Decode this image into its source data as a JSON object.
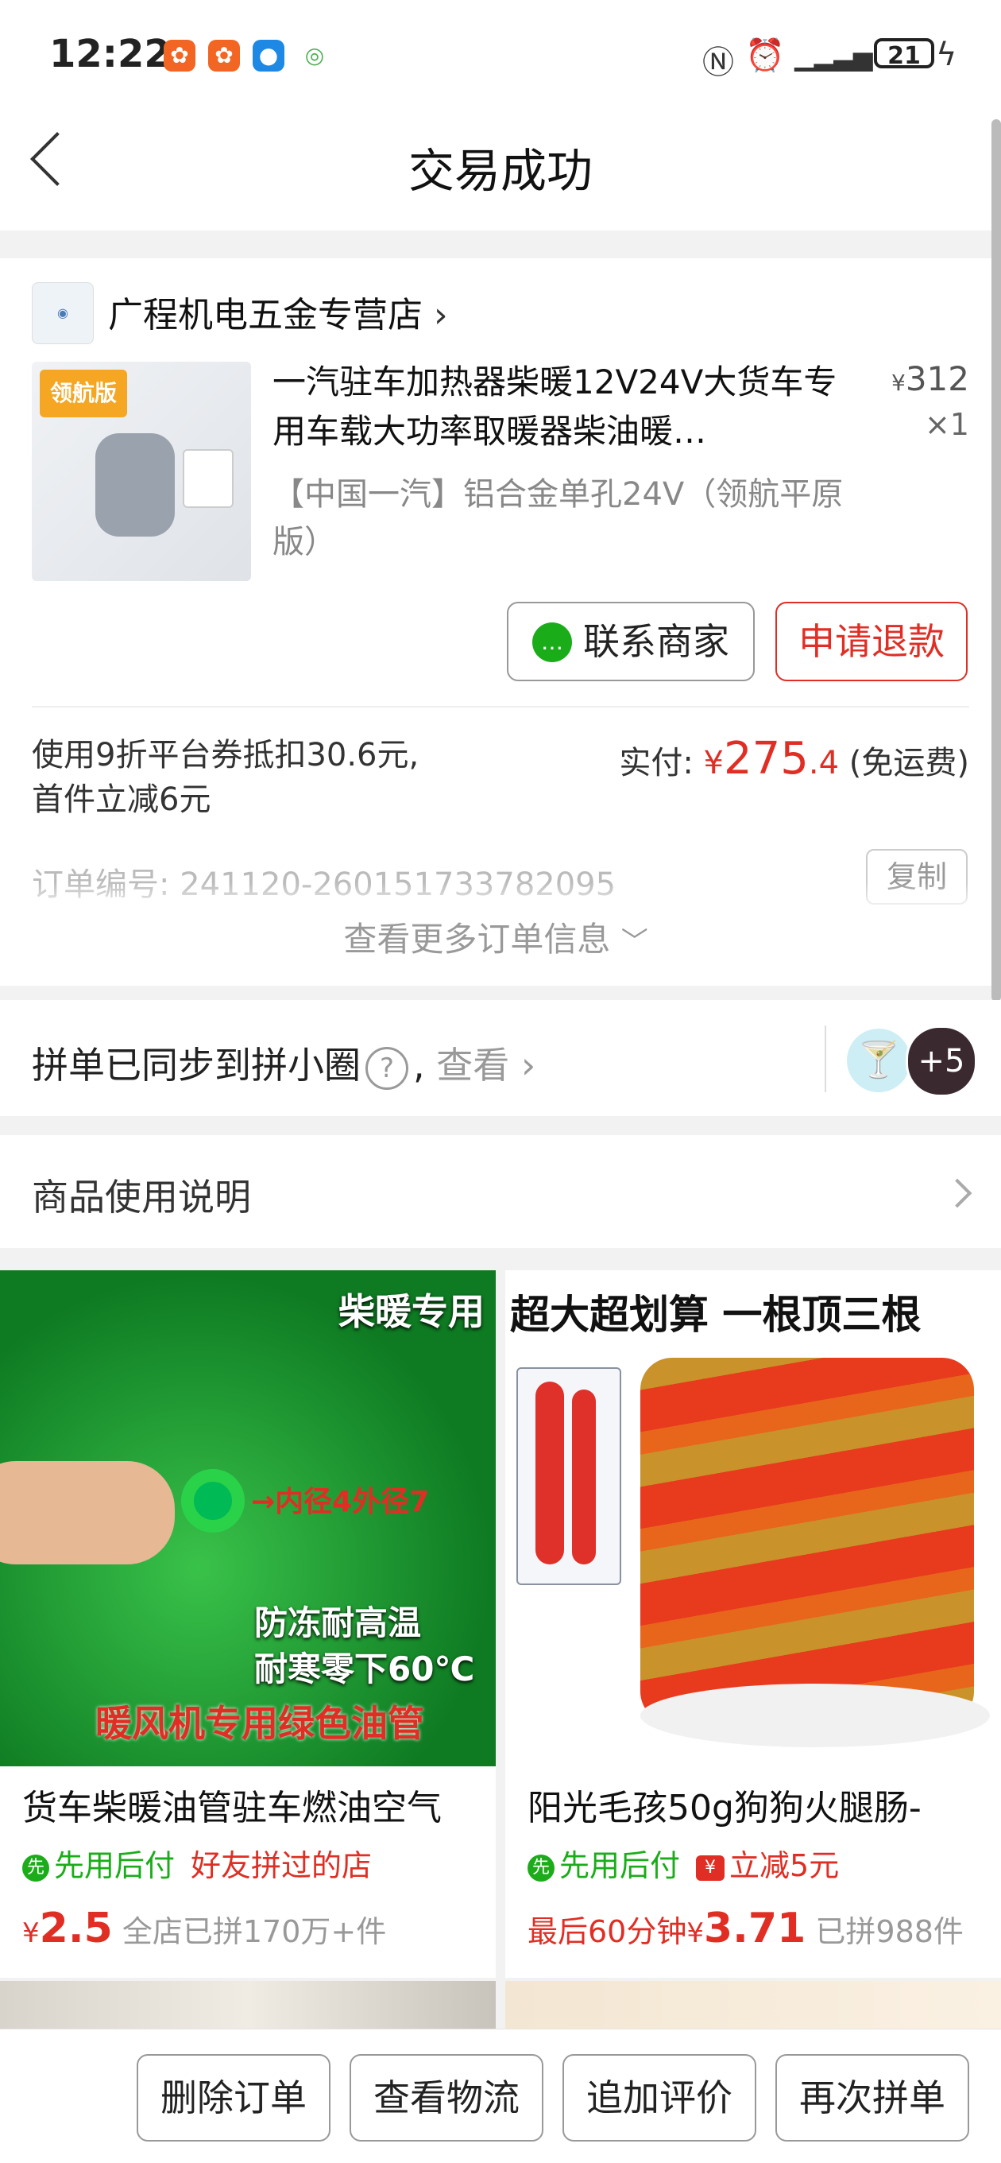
{
  "status_bar": {
    "time": "12:22",
    "battery": "21"
  },
  "header": {
    "title": "交易成功"
  },
  "order": {
    "shop_name": "广程机电五金专营店",
    "product": {
      "title": "一汽驻车加热器柴暖12V24V大货车专用车载大功率取暖器柴油暖…",
      "spec": "【中国一汽】铝合金单孔24V（领航平原版）",
      "price_currency": "¥",
      "price": "312",
      "quantity": "×1",
      "image_badge": "领航版"
    },
    "buttons": {
      "contact": "联系商家",
      "refund": "申请退款"
    },
    "discount_text": "使用9折平台券抵扣30.6元, 首件立减6元",
    "paid_label": "实付:",
    "paid_currency": "¥",
    "paid_int": "275",
    "paid_dec": ".4",
    "shipping_note": "(免运费)",
    "order_number_label": "订单编号:",
    "order_number": "241120-260151733782095",
    "copy": "复制",
    "more_info": "查看更多订单信息"
  },
  "pin_sync": {
    "text": "拼单已同步到拼小圈",
    "help": "?",
    "comma": ",",
    "view": "查看",
    "avatar_more": "+5"
  },
  "usage": {
    "label": "商品使用说明"
  },
  "recommendations": [
    {
      "image_text": {
        "tag": "柴暖专用",
        "arrow": "→内径4外径7",
        "line1": "防冻耐高温",
        "line2": "耐寒零下60℃",
        "line3": "暖风机专用绿色油管"
      },
      "name": "货车柴暖油管驻车燃油空气",
      "tag1": "先用后付",
      "tag2": "好友拼过的店",
      "price_prefix": "",
      "currency": "¥",
      "price": "2.5",
      "sold": "全店已拼170万+件"
    },
    {
      "image_text": {
        "banner": "超大超划算 一根顶三根"
      },
      "name": "阳光毛孩50g狗狗火腿肠-",
      "tag1": "先用后付",
      "tag2": "立减5元",
      "price_prefix": "最后60分钟",
      "currency": "¥",
      "price": "3.71",
      "sold": "已拼988件"
    }
  ],
  "bottom_bar": {
    "delete": "删除订单",
    "logistics": "查看物流",
    "review": "追加评价",
    "reorder": "再次拼单"
  },
  "colors": {
    "accent_red": "#e02e24",
    "pay_green": "#1aad19"
  }
}
